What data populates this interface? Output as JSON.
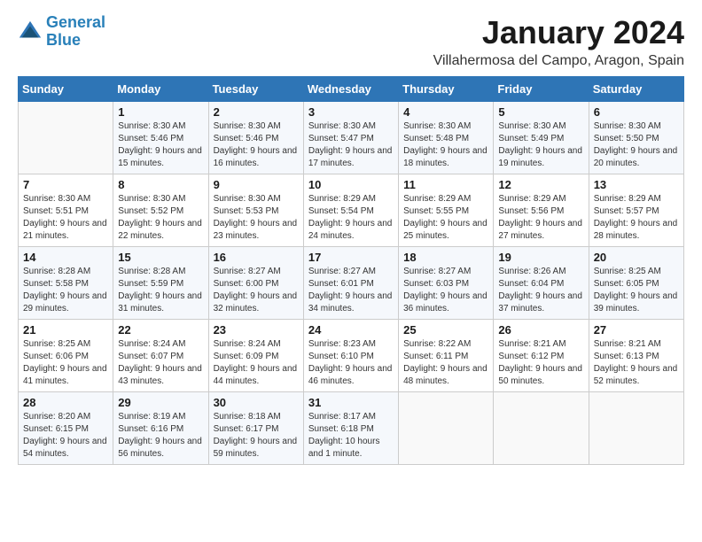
{
  "logo": {
    "line1": "General",
    "line2": "Blue"
  },
  "title": "January 2024",
  "subtitle": "Villahermosa del Campo, Aragon, Spain",
  "days_of_week": [
    "Sunday",
    "Monday",
    "Tuesday",
    "Wednesday",
    "Thursday",
    "Friday",
    "Saturday"
  ],
  "weeks": [
    [
      {
        "day": "",
        "sunrise": "",
        "sunset": "",
        "daylight": ""
      },
      {
        "day": "1",
        "sunrise": "Sunrise: 8:30 AM",
        "sunset": "Sunset: 5:46 PM",
        "daylight": "Daylight: 9 hours and 15 minutes."
      },
      {
        "day": "2",
        "sunrise": "Sunrise: 8:30 AM",
        "sunset": "Sunset: 5:46 PM",
        "daylight": "Daylight: 9 hours and 16 minutes."
      },
      {
        "day": "3",
        "sunrise": "Sunrise: 8:30 AM",
        "sunset": "Sunset: 5:47 PM",
        "daylight": "Daylight: 9 hours and 17 minutes."
      },
      {
        "day": "4",
        "sunrise": "Sunrise: 8:30 AM",
        "sunset": "Sunset: 5:48 PM",
        "daylight": "Daylight: 9 hours and 18 minutes."
      },
      {
        "day": "5",
        "sunrise": "Sunrise: 8:30 AM",
        "sunset": "Sunset: 5:49 PM",
        "daylight": "Daylight: 9 hours and 19 minutes."
      },
      {
        "day": "6",
        "sunrise": "Sunrise: 8:30 AM",
        "sunset": "Sunset: 5:50 PM",
        "daylight": "Daylight: 9 hours and 20 minutes."
      }
    ],
    [
      {
        "day": "7",
        "sunrise": "Sunrise: 8:30 AM",
        "sunset": "Sunset: 5:51 PM",
        "daylight": "Daylight: 9 hours and 21 minutes."
      },
      {
        "day": "8",
        "sunrise": "Sunrise: 8:30 AM",
        "sunset": "Sunset: 5:52 PM",
        "daylight": "Daylight: 9 hours and 22 minutes."
      },
      {
        "day": "9",
        "sunrise": "Sunrise: 8:30 AM",
        "sunset": "Sunset: 5:53 PM",
        "daylight": "Daylight: 9 hours and 23 minutes."
      },
      {
        "day": "10",
        "sunrise": "Sunrise: 8:29 AM",
        "sunset": "Sunset: 5:54 PM",
        "daylight": "Daylight: 9 hours and 24 minutes."
      },
      {
        "day": "11",
        "sunrise": "Sunrise: 8:29 AM",
        "sunset": "Sunset: 5:55 PM",
        "daylight": "Daylight: 9 hours and 25 minutes."
      },
      {
        "day": "12",
        "sunrise": "Sunrise: 8:29 AM",
        "sunset": "Sunset: 5:56 PM",
        "daylight": "Daylight: 9 hours and 27 minutes."
      },
      {
        "day": "13",
        "sunrise": "Sunrise: 8:29 AM",
        "sunset": "Sunset: 5:57 PM",
        "daylight": "Daylight: 9 hours and 28 minutes."
      }
    ],
    [
      {
        "day": "14",
        "sunrise": "Sunrise: 8:28 AM",
        "sunset": "Sunset: 5:58 PM",
        "daylight": "Daylight: 9 hours and 29 minutes."
      },
      {
        "day": "15",
        "sunrise": "Sunrise: 8:28 AM",
        "sunset": "Sunset: 5:59 PM",
        "daylight": "Daylight: 9 hours and 31 minutes."
      },
      {
        "day": "16",
        "sunrise": "Sunrise: 8:27 AM",
        "sunset": "Sunset: 6:00 PM",
        "daylight": "Daylight: 9 hours and 32 minutes."
      },
      {
        "day": "17",
        "sunrise": "Sunrise: 8:27 AM",
        "sunset": "Sunset: 6:01 PM",
        "daylight": "Daylight: 9 hours and 34 minutes."
      },
      {
        "day": "18",
        "sunrise": "Sunrise: 8:27 AM",
        "sunset": "Sunset: 6:03 PM",
        "daylight": "Daylight: 9 hours and 36 minutes."
      },
      {
        "day": "19",
        "sunrise": "Sunrise: 8:26 AM",
        "sunset": "Sunset: 6:04 PM",
        "daylight": "Daylight: 9 hours and 37 minutes."
      },
      {
        "day": "20",
        "sunrise": "Sunrise: 8:25 AM",
        "sunset": "Sunset: 6:05 PM",
        "daylight": "Daylight: 9 hours and 39 minutes."
      }
    ],
    [
      {
        "day": "21",
        "sunrise": "Sunrise: 8:25 AM",
        "sunset": "Sunset: 6:06 PM",
        "daylight": "Daylight: 9 hours and 41 minutes."
      },
      {
        "day": "22",
        "sunrise": "Sunrise: 8:24 AM",
        "sunset": "Sunset: 6:07 PM",
        "daylight": "Daylight: 9 hours and 43 minutes."
      },
      {
        "day": "23",
        "sunrise": "Sunrise: 8:24 AM",
        "sunset": "Sunset: 6:09 PM",
        "daylight": "Daylight: 9 hours and 44 minutes."
      },
      {
        "day": "24",
        "sunrise": "Sunrise: 8:23 AM",
        "sunset": "Sunset: 6:10 PM",
        "daylight": "Daylight: 9 hours and 46 minutes."
      },
      {
        "day": "25",
        "sunrise": "Sunrise: 8:22 AM",
        "sunset": "Sunset: 6:11 PM",
        "daylight": "Daylight: 9 hours and 48 minutes."
      },
      {
        "day": "26",
        "sunrise": "Sunrise: 8:21 AM",
        "sunset": "Sunset: 6:12 PM",
        "daylight": "Daylight: 9 hours and 50 minutes."
      },
      {
        "day": "27",
        "sunrise": "Sunrise: 8:21 AM",
        "sunset": "Sunset: 6:13 PM",
        "daylight": "Daylight: 9 hours and 52 minutes."
      }
    ],
    [
      {
        "day": "28",
        "sunrise": "Sunrise: 8:20 AM",
        "sunset": "Sunset: 6:15 PM",
        "daylight": "Daylight: 9 hours and 54 minutes."
      },
      {
        "day": "29",
        "sunrise": "Sunrise: 8:19 AM",
        "sunset": "Sunset: 6:16 PM",
        "daylight": "Daylight: 9 hours and 56 minutes."
      },
      {
        "day": "30",
        "sunrise": "Sunrise: 8:18 AM",
        "sunset": "Sunset: 6:17 PM",
        "daylight": "Daylight: 9 hours and 59 minutes."
      },
      {
        "day": "31",
        "sunrise": "Sunrise: 8:17 AM",
        "sunset": "Sunset: 6:18 PM",
        "daylight": "Daylight: 10 hours and 1 minute."
      },
      {
        "day": "",
        "sunrise": "",
        "sunset": "",
        "daylight": ""
      },
      {
        "day": "",
        "sunrise": "",
        "sunset": "",
        "daylight": ""
      },
      {
        "day": "",
        "sunrise": "",
        "sunset": "",
        "daylight": ""
      }
    ]
  ]
}
